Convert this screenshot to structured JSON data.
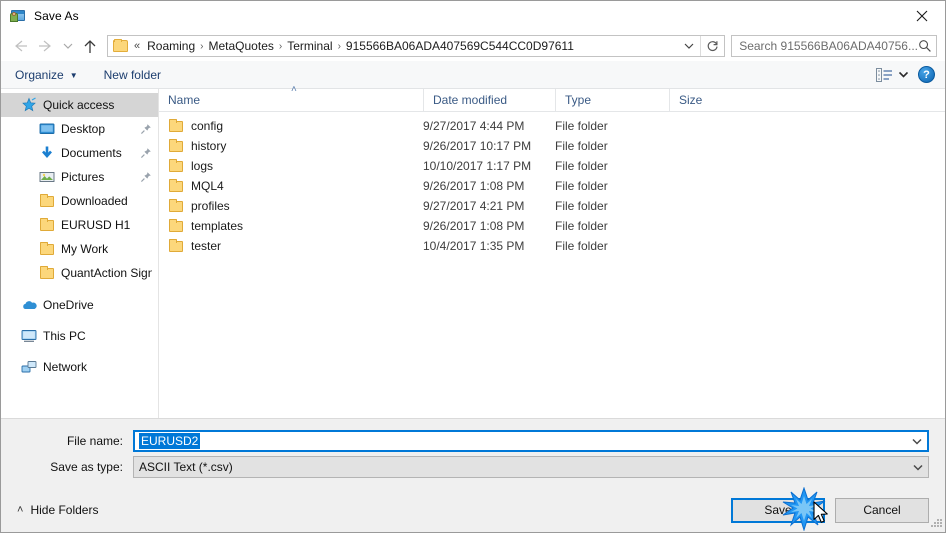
{
  "window": {
    "title": "Save As",
    "icon": "save-as-app-icon",
    "close_icon": "close-icon"
  },
  "nav": {
    "back_icon": "back-arrow-icon",
    "forward_icon": "forward-arrow-icon",
    "recent_icon": "recent-locations-chevron-icon",
    "up_icon": "up-arrow-icon",
    "address": {
      "folder_icon": "folder-icon",
      "prefix": "«",
      "crumbs": [
        "Roaming",
        "MetaQuotes",
        "Terminal",
        "915566BA06ADA407569C544CC0D97611"
      ],
      "separator": "›",
      "dropdown_icon": "chevron-down-icon",
      "refresh_icon": "refresh-icon"
    },
    "search": {
      "placeholder": "Search 915566BA06ADA40756...",
      "icon": "search-icon"
    }
  },
  "toolbar": {
    "organize_label": "Organize",
    "organize_caret": "▼",
    "new_folder_label": "New folder",
    "view_icon": "view-layout-icon",
    "view_caret_icon": "chevron-down-icon",
    "help_label": "?",
    "help_icon": "help-icon"
  },
  "sidebar": {
    "items": [
      {
        "label": "Quick access",
        "icon": "quick-access-star-icon",
        "level": 0,
        "selected": true,
        "pinned": false
      },
      {
        "label": "Desktop",
        "icon": "desktop-icon",
        "level": 1,
        "selected": false,
        "pinned": true
      },
      {
        "label": "Documents",
        "icon": "documents-download-icon",
        "level": 1,
        "selected": false,
        "pinned": true
      },
      {
        "label": "Pictures",
        "icon": "pictures-icon",
        "level": 1,
        "selected": false,
        "pinned": true
      },
      {
        "label": "Downloaded",
        "icon": "folder-icon",
        "level": 1,
        "selected": false,
        "pinned": false
      },
      {
        "label": "EURUSD H1",
        "icon": "folder-icon",
        "level": 1,
        "selected": false,
        "pinned": false
      },
      {
        "label": "My Work",
        "icon": "folder-icon",
        "level": 1,
        "selected": false,
        "pinned": false
      },
      {
        "label": "QuantAction Signal",
        "icon": "folder-icon",
        "level": 1,
        "selected": false,
        "pinned": false
      },
      {
        "label": "OneDrive",
        "icon": "onedrive-cloud-icon",
        "level": 0,
        "selected": false,
        "pinned": false
      },
      {
        "label": "This PC",
        "icon": "this-pc-icon",
        "level": 0,
        "selected": false,
        "pinned": false
      },
      {
        "label": "Network",
        "icon": "network-icon",
        "level": 0,
        "selected": false,
        "pinned": false
      }
    ]
  },
  "filelist": {
    "columns": [
      "Name",
      "Date modified",
      "Type",
      "Size"
    ],
    "sort_indicator": "˄",
    "rows": [
      {
        "name": "config",
        "icon": "folder-icon",
        "date": "9/27/2017 4:44 PM",
        "type": "File folder",
        "size": ""
      },
      {
        "name": "history",
        "icon": "folder-icon",
        "date": "9/26/2017 10:17 PM",
        "type": "File folder",
        "size": ""
      },
      {
        "name": "logs",
        "icon": "folder-icon",
        "date": "10/10/2017 1:17 PM",
        "type": "File folder",
        "size": ""
      },
      {
        "name": "MQL4",
        "icon": "folder-icon",
        "date": "9/26/2017 1:08 PM",
        "type": "File folder",
        "size": ""
      },
      {
        "name": "profiles",
        "icon": "folder-icon",
        "date": "9/27/2017 4:21 PM",
        "type": "File folder",
        "size": ""
      },
      {
        "name": "templates",
        "icon": "folder-icon",
        "date": "9/26/2017 1:08 PM",
        "type": "File folder",
        "size": ""
      },
      {
        "name": "tester",
        "icon": "folder-icon",
        "date": "10/4/2017 1:35 PM",
        "type": "File folder",
        "size": ""
      }
    ]
  },
  "form": {
    "file_name_label": "File name:",
    "file_name_value": "EURUSD2",
    "file_name_caret_icon": "chevron-down-icon",
    "save_as_type_label": "Save as type:",
    "save_as_type_value": "ASCII Text (*.csv)",
    "save_as_type_caret_icon": "chevron-down-icon"
  },
  "footer": {
    "hide_folders_label": "Hide Folders",
    "hide_folders_caret": "˄",
    "save_label": "Save",
    "cancel_label": "Cancel",
    "resize_grip_icon": "resize-grip-icon",
    "cursor_icon": "mouse-cursor-icon",
    "click_effect_icon": "click-burst-icon"
  },
  "colors": {
    "accent": "#0078d7",
    "folder": "#fcd77b",
    "crumb_text": "#1c1c1c",
    "column_header_text": "#3a5a85",
    "selection": "#d5d5d5"
  }
}
